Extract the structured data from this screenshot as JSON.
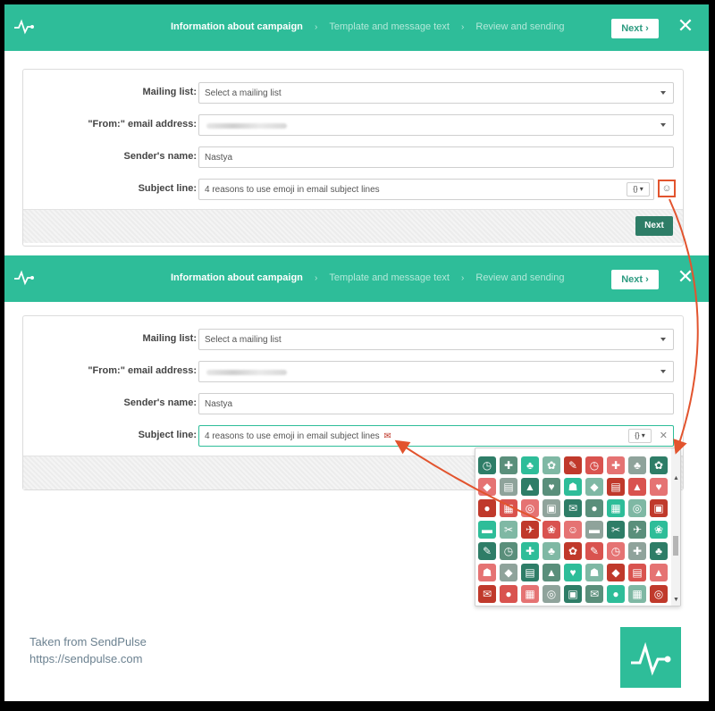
{
  "header": {
    "steps": [
      "Information about campaign",
      "Template and message text",
      "Review and sending"
    ],
    "separator": "›",
    "next_label": "Next",
    "next_chevron": "›",
    "close_symbol": "✕"
  },
  "form": {
    "mailing_list_label": "Mailing list:",
    "mailing_list_value": "Select a mailing list",
    "from_label": "\"From:\" email address:",
    "sender_label": "Sender's name:",
    "sender_value": "Nastya",
    "subject_label": "Subject line:",
    "subject_value": "4 reasons to use emoji in email subject lines",
    "variables_button": "{} ▾",
    "emoji_button": "☺",
    "clear_symbol": "✕",
    "next_label": "Next"
  },
  "emoji_picker": {
    "scroll_up": "▲",
    "scroll_down": "▼",
    "inserted_emoji": "✉"
  },
  "credit": {
    "line1": "Taken from SendPulse",
    "line2": "https://sendpulse.com"
  },
  "colors": {
    "brand_green": "#2ebd99",
    "dark_green": "#2e7d67",
    "annotation_red": "#e2542e"
  }
}
